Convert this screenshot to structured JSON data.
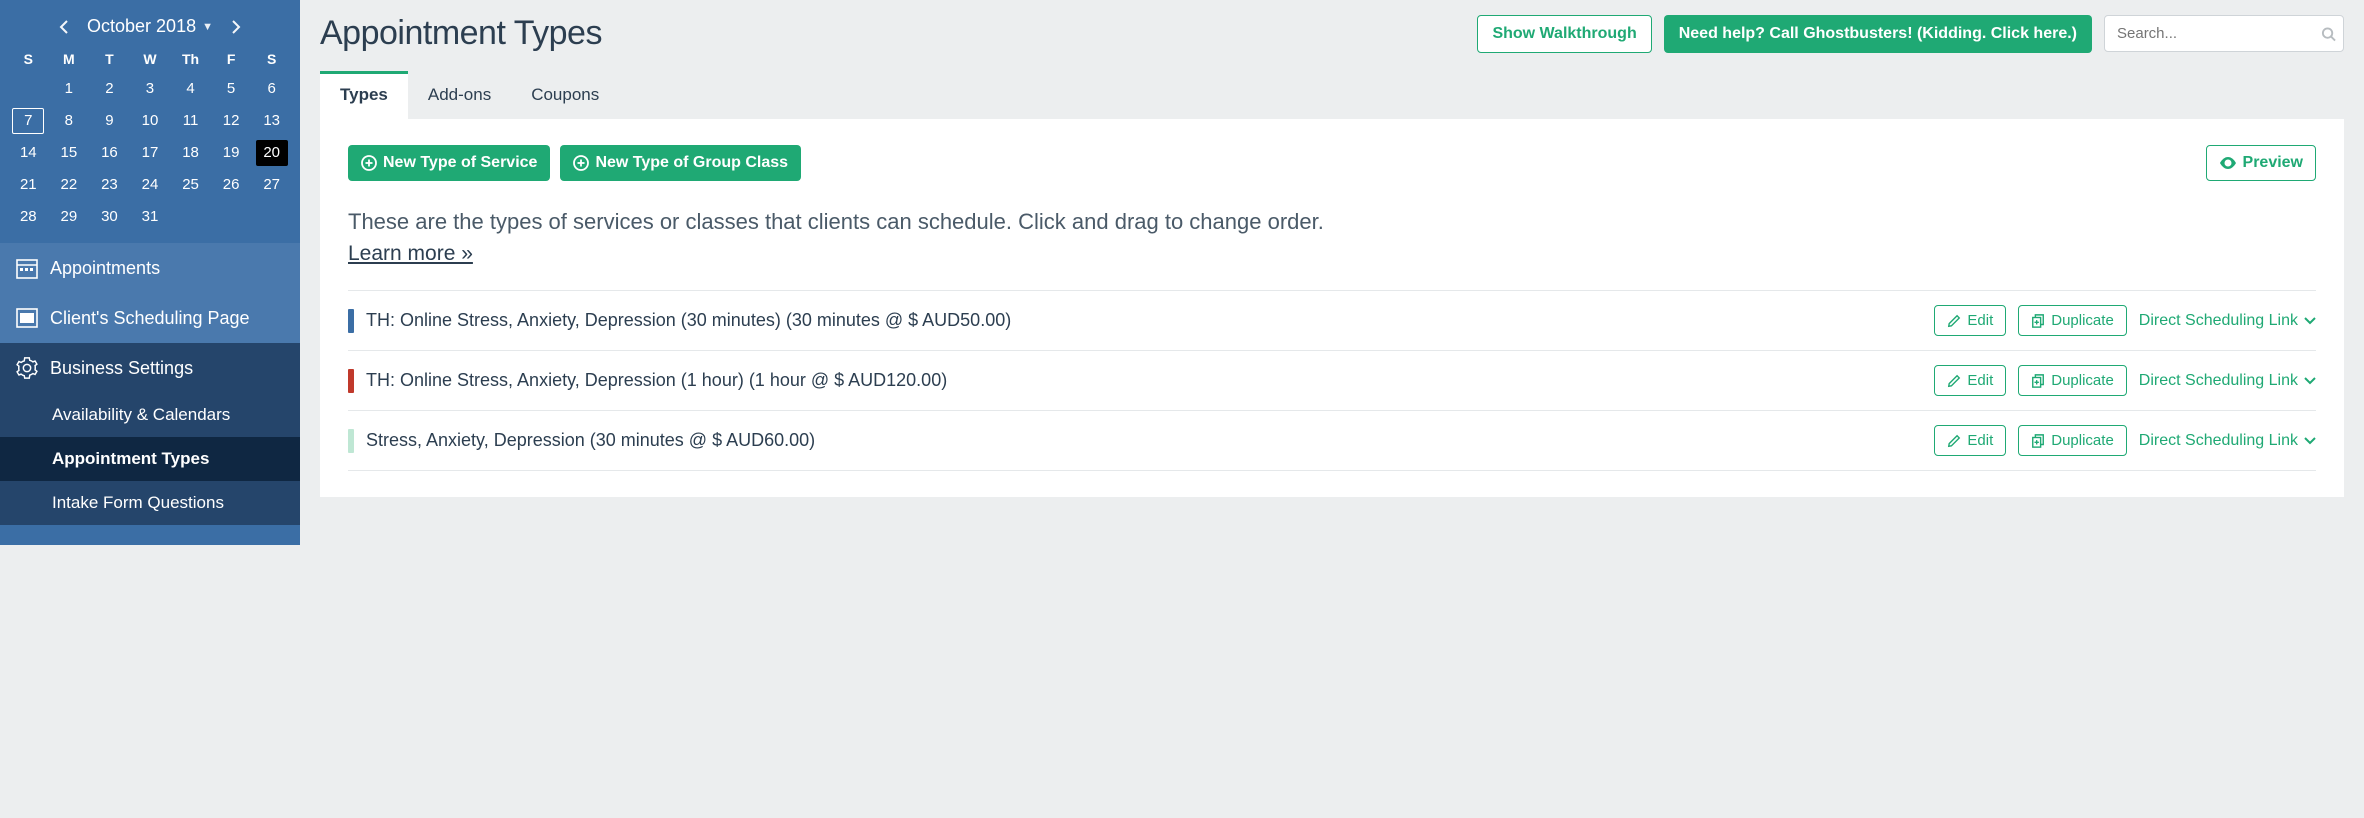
{
  "calendar": {
    "title": "October 2018",
    "dow": [
      "S",
      "M",
      "T",
      "W",
      "Th",
      "F",
      "S"
    ],
    "weeks": [
      [
        "",
        "1",
        "2",
        "3",
        "4",
        "5",
        "6"
      ],
      [
        "7",
        "8",
        "9",
        "10",
        "11",
        "12",
        "13"
      ],
      [
        "14",
        "15",
        "16",
        "17",
        "18",
        "19",
        "20"
      ],
      [
        "21",
        "22",
        "23",
        "24",
        "25",
        "26",
        "27"
      ],
      [
        "28",
        "29",
        "30",
        "31",
        "",
        "",
        ""
      ]
    ],
    "selected": "7",
    "today": "20"
  },
  "sidebar": {
    "appointments": "Appointments",
    "client_page": "Client's Scheduling Page",
    "business": "Business Settings",
    "sub": {
      "availability": "Availability & Calendars",
      "types": "Appointment Types",
      "intake": "Intake Form Questions"
    }
  },
  "header": {
    "title": "Appointment Types",
    "walkthrough": "Show Walkthrough",
    "help": "Need help? Call Ghostbusters! (Kidding. Click here.)",
    "search_placeholder": "Search..."
  },
  "tabs": {
    "types": "Types",
    "addons": "Add-ons",
    "coupons": "Coupons"
  },
  "panel": {
    "new_service": "New Type of Service",
    "new_group": "New Type of Group Class",
    "preview": "Preview",
    "intro": "These are the types of services or classes that clients can schedule. Click and drag to change order.",
    "learn": "Learn more »",
    "edit": "Edit",
    "duplicate": "Duplicate",
    "dsl": "Direct Scheduling Link",
    "rows": [
      {
        "color": "#3b6ea5",
        "title": "TH: Online Stress, Anxiety, Depression (30 minutes) (30 minutes @ $ AUD50.00)"
      },
      {
        "color": "#c0392b",
        "title": "TH: Online Stress, Anxiety, Depression (1 hour) (1 hour @ $ AUD120.00)"
      },
      {
        "color": "#bfe7d4",
        "title": "Stress, Anxiety, Depression (30 minutes @ $ AUD60.00)"
      }
    ]
  }
}
